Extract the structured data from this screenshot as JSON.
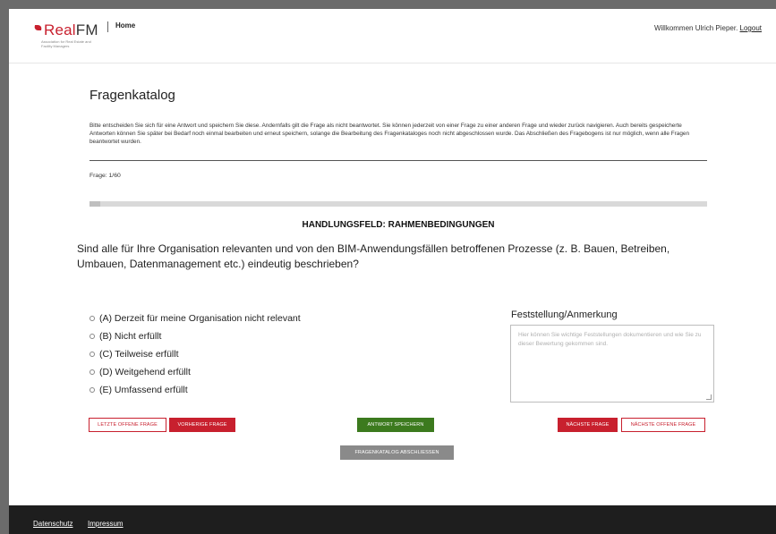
{
  "header": {
    "logo_prefix": "Real",
    "logo_suffix": "FM",
    "logo_sub": "Association for Real Estate and Facility Managers",
    "nav_home": "Home",
    "welcome_text": "Willkommen Ulrich Pieper.",
    "logout": "Logout"
  },
  "main": {
    "title": "Fragenkatalog",
    "intro": "Bitte entscheiden Sie sich für eine Antwort und speichern Sie diese. Andernfalls gilt die Frage als nicht beantwortet. Sie können jederzeit von einer Frage zu einer anderen Frage und wieder zurück navigieren. Auch bereits gespeicherte Antworten können Sie später bei Bedarf noch einmal bearbeiten und erneut speichern, solange die Bearbeitung des Fragenkataloges noch nicht abgeschlossen wurde. Das Abschließen des Fragebogens ist nur möglich, wenn alle Fragen beantwortet wurden.",
    "counter": "Frage: 1/60",
    "progress_fraction": 0.0167,
    "section": "HANDLUNGSFELD: RAHMENBEDINGUNGEN",
    "question": "Sind alle für Ihre Organisation relevanten und von den BIM-Anwendungsfällen betroffenen Prozesse (z. B. Bauen, Betreiben, Umbauen, Datenmanagement etc.) eindeutig beschrieben?",
    "options": [
      "(A) Derzeit für meine Organisation nicht relevant",
      "(B) Nicht erfüllt",
      "(C) Teilweise erfüllt",
      "(D) Weitgehend erfüllt",
      "(E) Umfassend erfüllt"
    ],
    "note_label": "Feststellung/Anmerkung",
    "note_placeholder": "Hier können Sie wichtige Feststellungen dokumentieren und wie Sie zu dieser Bewertung gekommen sind."
  },
  "buttons": {
    "last_open": "LETZTE OFFENE FRAGE",
    "previous": "VORHERIGE FRAGE",
    "save": "ANTWORT SPEICHERN",
    "next": "NÄCHSTE FRAGE",
    "next_open": "NÄCHSTE OFFENE FRAGE",
    "finish": "FRAGENKATALOG ABSCHLIESSEN"
  },
  "footer": {
    "privacy": "Datenschutz",
    "imprint": "Impressum"
  },
  "colors": {
    "brand_red": "#c8202e",
    "save_green": "#3c7a1e",
    "finish_gray": "#8a8a8a",
    "footer_bg": "#1e1e1e"
  }
}
